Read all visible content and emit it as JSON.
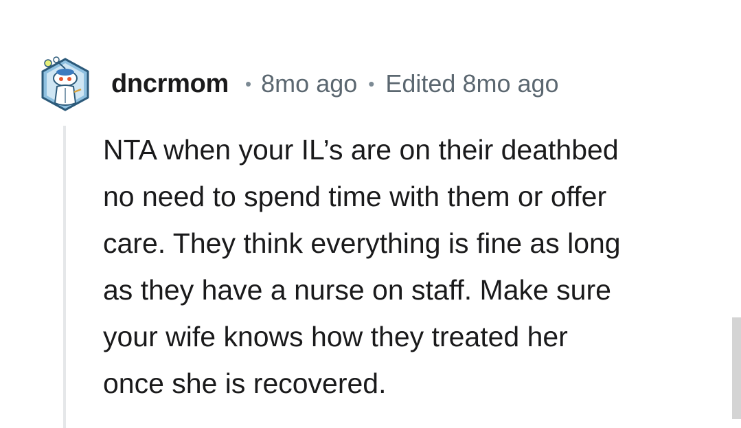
{
  "comment": {
    "author": "dncrmom",
    "age": "8mo ago",
    "edited": "Edited 8mo ago",
    "body_lines": [
      "NTA when your IL’s are on their deathbed",
      "no need to spend time with them or offer",
      "care. They think everything is fine as long",
      "as they have a nurse on staff. Make sure",
      "your wife knows how they treated her",
      "once she is recovered."
    ]
  },
  "icons": {
    "avatar": "snoo-avatar-icon"
  },
  "colors": {
    "text": "#1a1a1b",
    "meta": "#5b6770",
    "thread_line": "#e5e7e9",
    "avatar_hex": "#7fb3d6"
  }
}
